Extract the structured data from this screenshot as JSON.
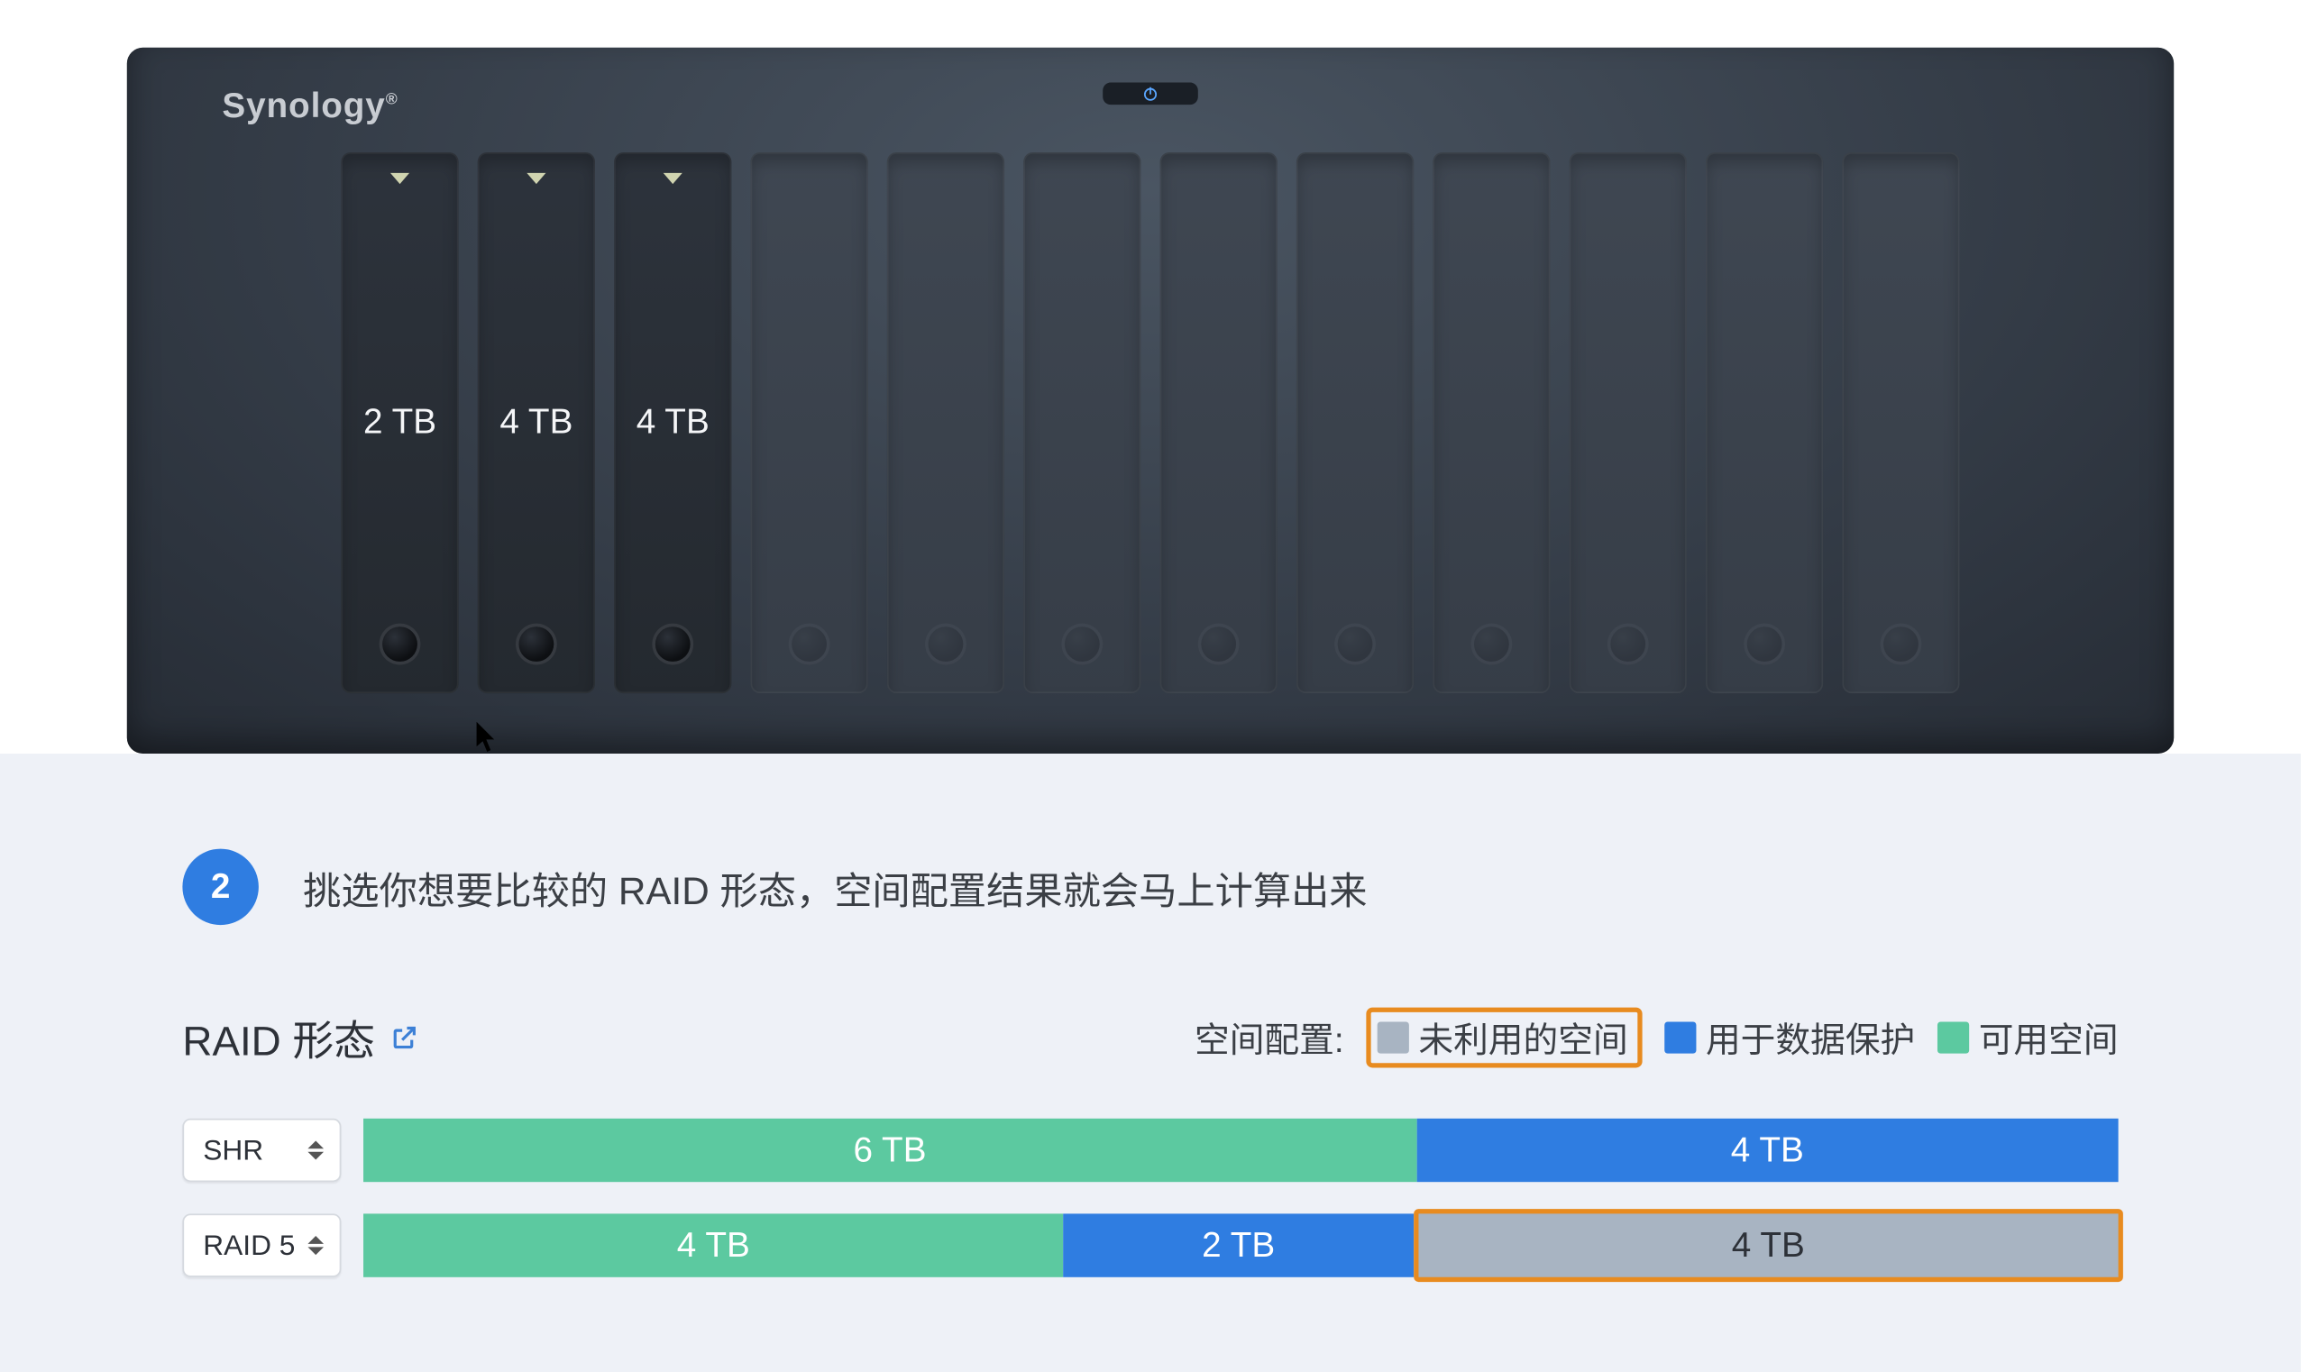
{
  "brand": "Synology",
  "nas": {
    "bays": [
      {
        "filled": true,
        "capacity": "2 TB"
      },
      {
        "filled": true,
        "capacity": "4 TB"
      },
      {
        "filled": true,
        "capacity": "4 TB"
      },
      {
        "filled": false
      },
      {
        "filled": false
      },
      {
        "filled": false
      },
      {
        "filled": false
      },
      {
        "filled": false
      },
      {
        "filled": false
      },
      {
        "filled": false
      },
      {
        "filled": false
      },
      {
        "filled": false
      }
    ]
  },
  "step": {
    "number": "2",
    "text": "挑选你想要比较的 RAID 形态，空间配置结果就会马上计算出来"
  },
  "raid_title": "RAID 形态",
  "legend": {
    "label": "空间配置:",
    "unused": "未利用的空间",
    "protect": "用于数据保护",
    "avail": "可用空间"
  },
  "rows": [
    {
      "type": "SHR",
      "segments": [
        {
          "kind": "avail",
          "label": "6 TB",
          "tb": 6
        },
        {
          "kind": "protect",
          "label": "4 TB",
          "tb": 4
        }
      ],
      "total_tb": 10
    },
    {
      "type": "RAID 5",
      "segments": [
        {
          "kind": "avail",
          "label": "4 TB",
          "tb": 4
        },
        {
          "kind": "protect",
          "label": "2 TB",
          "tb": 2
        },
        {
          "kind": "unused",
          "label": "4 TB",
          "tb": 4
        }
      ],
      "total_tb": 10
    }
  ],
  "chart_data": {
    "type": "bar",
    "title": "RAID 形态 空间配置",
    "unit": "TB",
    "series_meaning": {
      "avail": "可用空间",
      "protect": "用于数据保护",
      "unused": "未利用的空间"
    },
    "items": [
      {
        "raid": "SHR",
        "avail": 6,
        "protect": 4,
        "unused": 0
      },
      {
        "raid": "RAID 5",
        "avail": 4,
        "protect": 2,
        "unused": 4
      }
    ]
  }
}
